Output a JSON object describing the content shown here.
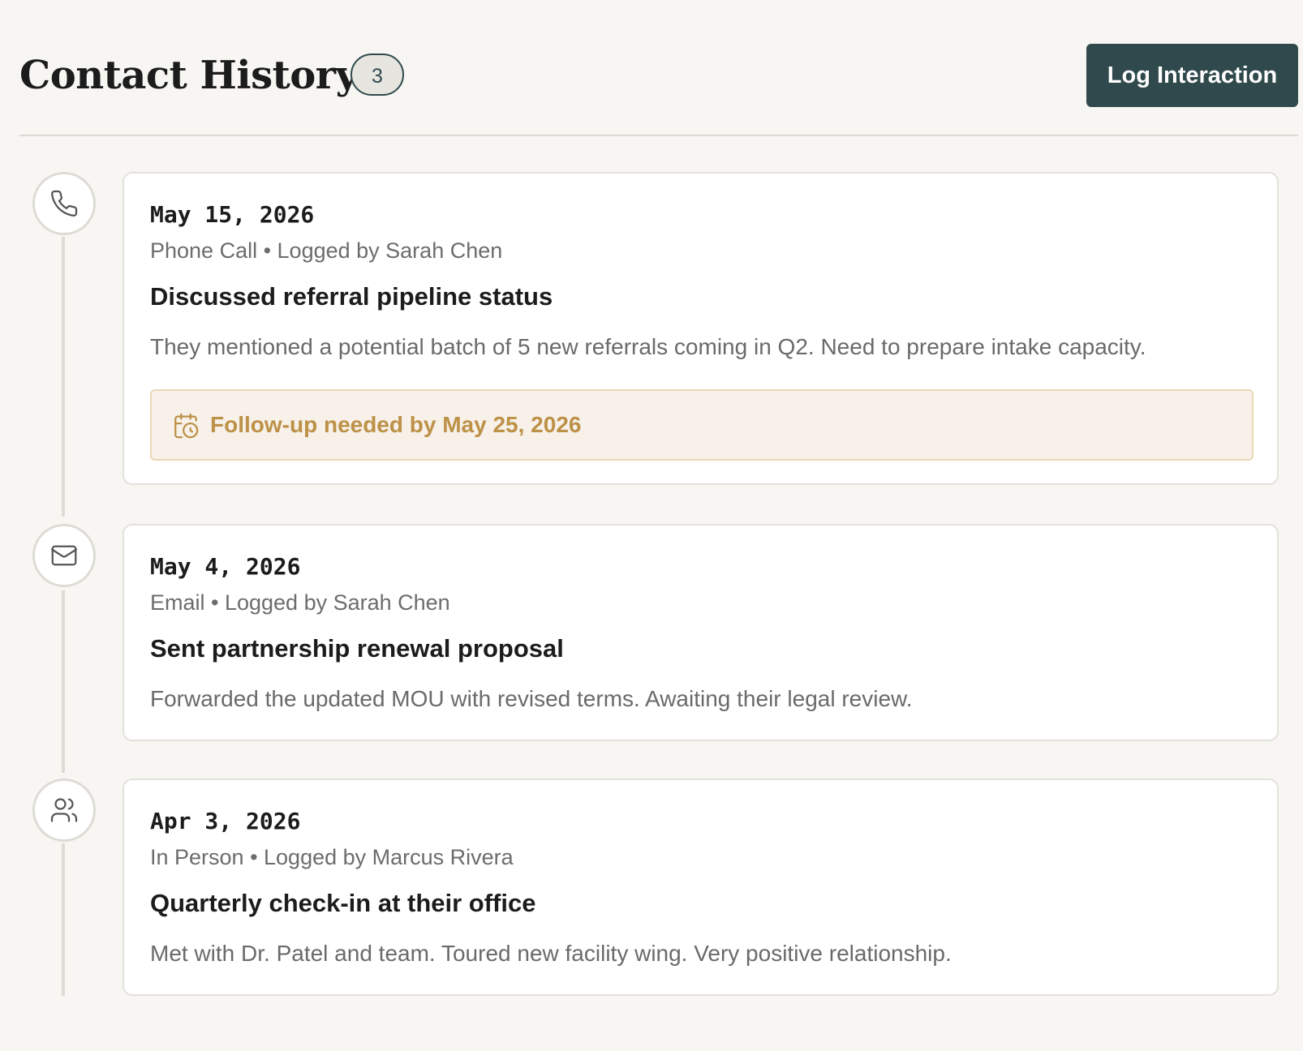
{
  "header": {
    "title": "Contact History",
    "count": "3",
    "log_button_label": "Log Interaction"
  },
  "colors": {
    "background": "#f7f6f3",
    "primary_button": "#30494d",
    "timeline": "#dedbd4",
    "followup_text": "#bd9147",
    "followup_bg": "#f7f1ea"
  },
  "interactions": [
    {
      "icon": "phone-icon",
      "date": "May 15, 2026",
      "meta": "Phone Call • Logged by Sarah Chen",
      "subject": "Discussed referral pipeline status",
      "notes": "They mentioned a potential batch of 5 new referrals coming in Q2. Need to prepare intake capacity.",
      "followup": {
        "icon": "calendar-clock-icon",
        "text": "Follow-up needed by May 25, 2026"
      }
    },
    {
      "icon": "mail-icon",
      "date": "May 4, 2026",
      "meta": "Email • Logged by Sarah Chen",
      "subject": "Sent partnership renewal proposal",
      "notes": "Forwarded the updated MOU with revised terms. Awaiting their legal review."
    },
    {
      "icon": "users-icon",
      "date": "Apr 3, 2026",
      "meta": "In Person • Logged by Marcus Rivera",
      "subject": "Quarterly check-in at their office",
      "notes": "Met with Dr. Patel and team. Toured new facility wing. Very positive relationship."
    }
  ]
}
